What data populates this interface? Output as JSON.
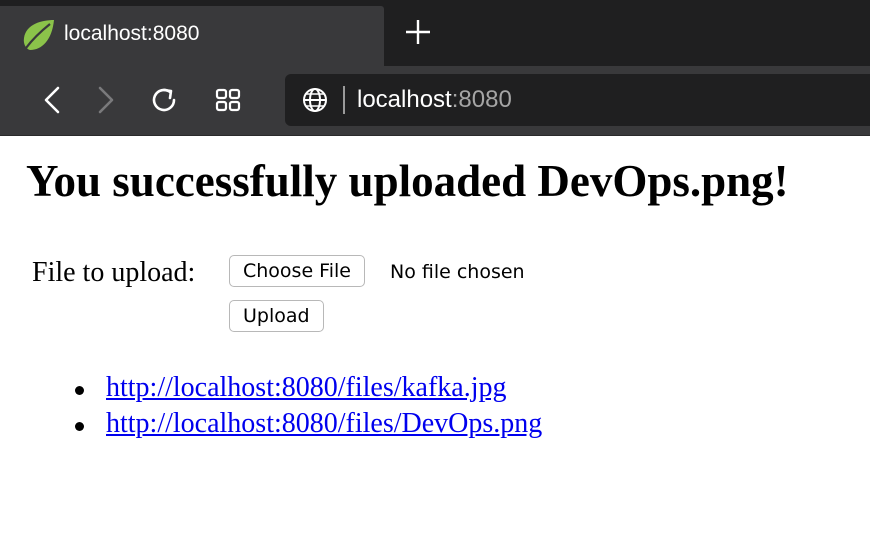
{
  "browser": {
    "tab": {
      "title": "localhost:8080",
      "favicon": "spring-leaf-icon"
    },
    "new_tab_label": "+",
    "toolbar": {
      "back_icon": "chevron-left-icon",
      "forward_icon": "chevron-right-icon",
      "reload_icon": "reload-icon",
      "tabs_icon": "grid-icon"
    },
    "address_bar": {
      "globe_icon": "globe-icon",
      "host": "localhost",
      "port": ":8080"
    }
  },
  "page": {
    "title": "You successfully uploaded DevOps.png!",
    "form": {
      "file_label": "File to upload:",
      "choose_file_label": "Choose File",
      "no_file_text": "No file chosen",
      "upload_label": "Upload"
    },
    "files": [
      {
        "url": "http://localhost:8080/files/kafka.jpg"
      },
      {
        "url": "http://localhost:8080/files/DevOps.png"
      }
    ]
  },
  "colors": {
    "tab_strip": "#1f1f20",
    "tab_active": "#39393b",
    "toolbar": "#39393b",
    "address_bar": "#1f1f20",
    "link": "#0000ee",
    "spring_green": "#8bc34a"
  }
}
